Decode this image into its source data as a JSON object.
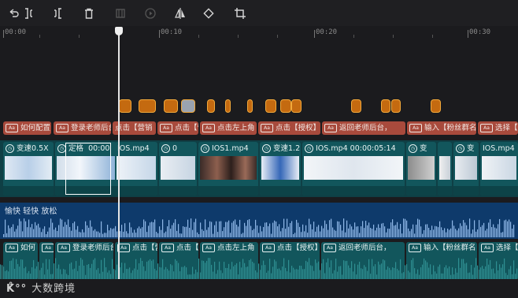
{
  "toolbar": {
    "icons": [
      "split-left-icon",
      "split-right-icon",
      "delete-icon",
      "freeze-frame-icon",
      "play-icon",
      "mirror-icon",
      "rotate-icon",
      "crop-icon"
    ]
  },
  "ruler": {
    "labels": [
      "00:00",
      "00:10",
      "00:20",
      "00:30"
    ]
  },
  "annotations": [
    {
      "text": "如何配置"
    },
    {
      "text": "登录老师后台"
    },
    {
      "text": "点击【营销"
    },
    {
      "text": "点击【营"
    },
    {
      "text": "点击左上角"
    },
    {
      "text": "点击【授权】"
    },
    {
      "text": "返回老师后台，"
    },
    {
      "text": "点击"
    },
    {
      "text": "输入【粉丝群名"
    },
    {
      "text": "选择【"
    }
  ],
  "video_clips": [
    {
      "text": "变速0.5X"
    },
    {
      "text": "定格"
    },
    {
      "text": "00:00"
    },
    {
      "text": "IOS.mp4"
    },
    {
      "text": "0"
    },
    {
      "text": "IOS1.mp4"
    },
    {
      "text": "变速1.2"
    },
    {
      "text": "IOS.mp4  00:00:05:14"
    },
    {
      "text": "变"
    },
    {
      "text": "变"
    },
    {
      "text": "IOS.mp4"
    }
  ],
  "audio": {
    "label": "愉快 轻快 放松"
  },
  "bottom_clips": [
    {
      "text": "如何"
    },
    {
      "text": "如"
    },
    {
      "text": "登录老师后台"
    },
    {
      "text": "点击【营"
    },
    {
      "text": "点击【"
    },
    {
      "text": "点击左上角"
    },
    {
      "text": "点击【授权】"
    },
    {
      "text": "返回老师后台，"
    },
    {
      "text": "点击"
    },
    {
      "text": "输入【粉丝群名"
    },
    {
      "text": "选择【"
    }
  ],
  "watermark": {
    "logo": "K̊°°",
    "text": "大数跨境"
  },
  "colors": {
    "accent": "#f2a93b",
    "annotation": "#a84a3c",
    "video": "#12565c",
    "audio": "#0e3a6b"
  }
}
